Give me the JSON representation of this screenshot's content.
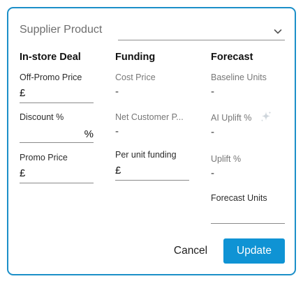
{
  "supplier_product": {
    "label": "Supplier Product",
    "value": ""
  },
  "columns": {
    "deal": {
      "heading": "In-store Deal",
      "off_promo_price": {
        "label": "Off-Promo Price",
        "prefix": "£",
        "value": ""
      },
      "discount": {
        "label": "Discount %",
        "suffix": "%",
        "value": ""
      },
      "promo_price": {
        "label": "Promo Price",
        "prefix": "£",
        "value": ""
      }
    },
    "funding": {
      "heading": "Funding",
      "cost_price": {
        "label": "Cost Price",
        "value": "-"
      },
      "net_customer_price": {
        "label": "Net Customer P...",
        "value": "-"
      },
      "per_unit_funding": {
        "label": "Per unit funding",
        "prefix": "£",
        "value": ""
      }
    },
    "forecast": {
      "heading": "Forecast",
      "baseline_units": {
        "label": "Baseline Units",
        "value": "-"
      },
      "ai_uplift": {
        "label": "AI Uplift %",
        "value": "-",
        "icon": "sparkle-icon"
      },
      "uplift": {
        "label": "Uplift %",
        "value": "-"
      },
      "forecast_units": {
        "label": "Forecast Units",
        "value": ""
      }
    }
  },
  "actions": {
    "cancel_label": "Cancel",
    "update_label": "Update"
  },
  "colors": {
    "border": "#1b8fc8",
    "primary": "#0f93d4"
  }
}
